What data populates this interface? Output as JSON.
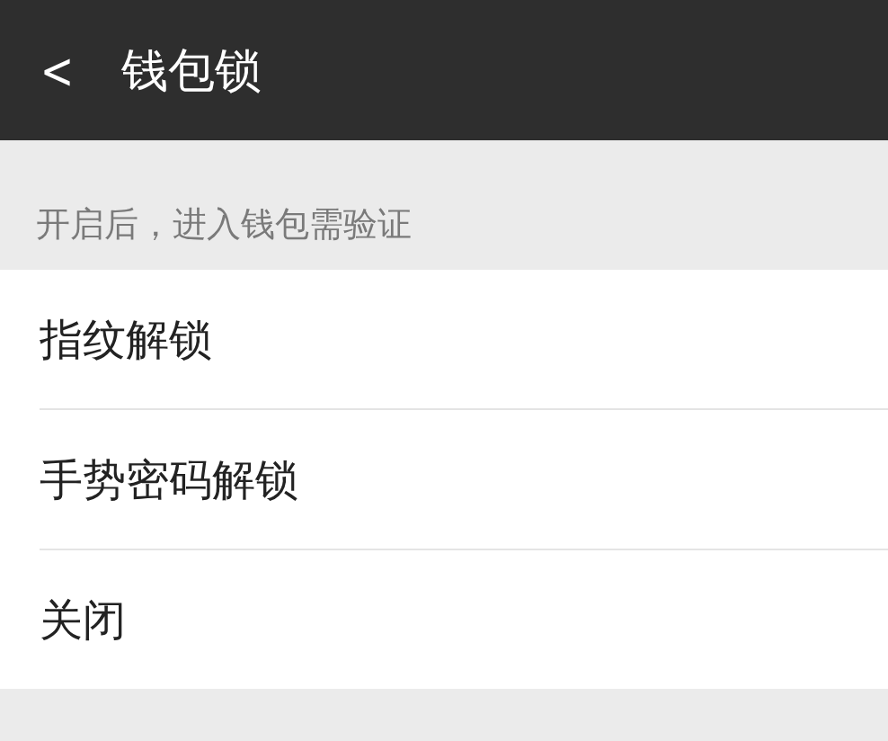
{
  "header": {
    "back": "<",
    "title": "钱包锁"
  },
  "hint": "开启后，进入钱包需验证",
  "options": [
    {
      "label": "指纹解锁"
    },
    {
      "label": "手势密码解锁"
    },
    {
      "label": "关闭"
    }
  ]
}
